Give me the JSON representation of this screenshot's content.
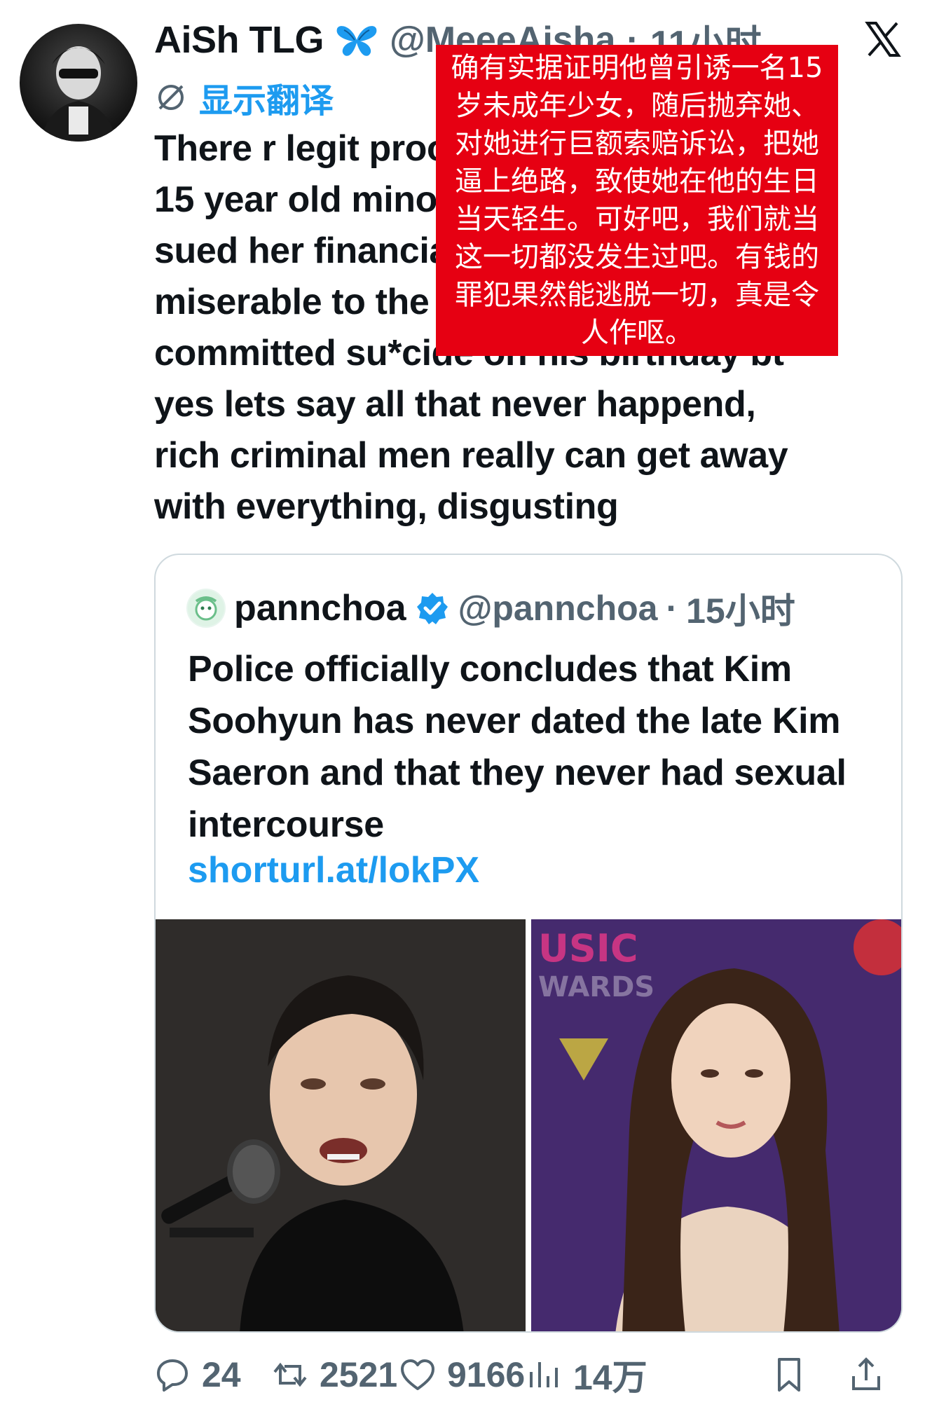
{
  "author": {
    "display_name": "AiSh TLG",
    "handle": "@MeeeAisha",
    "dot": "·",
    "time": "11小时",
    "badge_icon": "butterfly-icon"
  },
  "translate_label": "显示翻译",
  "tweet_text": "There r legit proof he groomed a\n15 year old minor, abandoned her,\nsued her financially, made her life\nmiserable to the point she\ncommitted su*cide on his birthday bt\nyes lets say all that never happend,\nrich criminal men really can get away\nwith everything, disgusting",
  "translation_overlay": "确有实据证明他曾引诱一名15岁未成年少女，随后抛弃她、对她进行巨额索赔诉讼，把她逼上绝路，致使她在他的生日当天轻生。可好吧，我们就当这一切都没发生过吧。有钱的罪犯果然能逃脱一切，真是令人作呕。",
  "quote": {
    "name": "pannchoa",
    "handle": "@pannchoa",
    "dot": "·",
    "time": "15小时",
    "text": "Police officially concludes that Kim Soohyun has never dated the late Kim Saeron and that they never had sexual intercourse",
    "link": "shorturl.at/lokPX"
  },
  "actions": {
    "replies": "24",
    "reposts": "2521",
    "likes": "9166",
    "views": "14万"
  },
  "colors": {
    "accent": "#1d9bf0",
    "muted": "#536471",
    "overlay_red": "#e60012"
  }
}
